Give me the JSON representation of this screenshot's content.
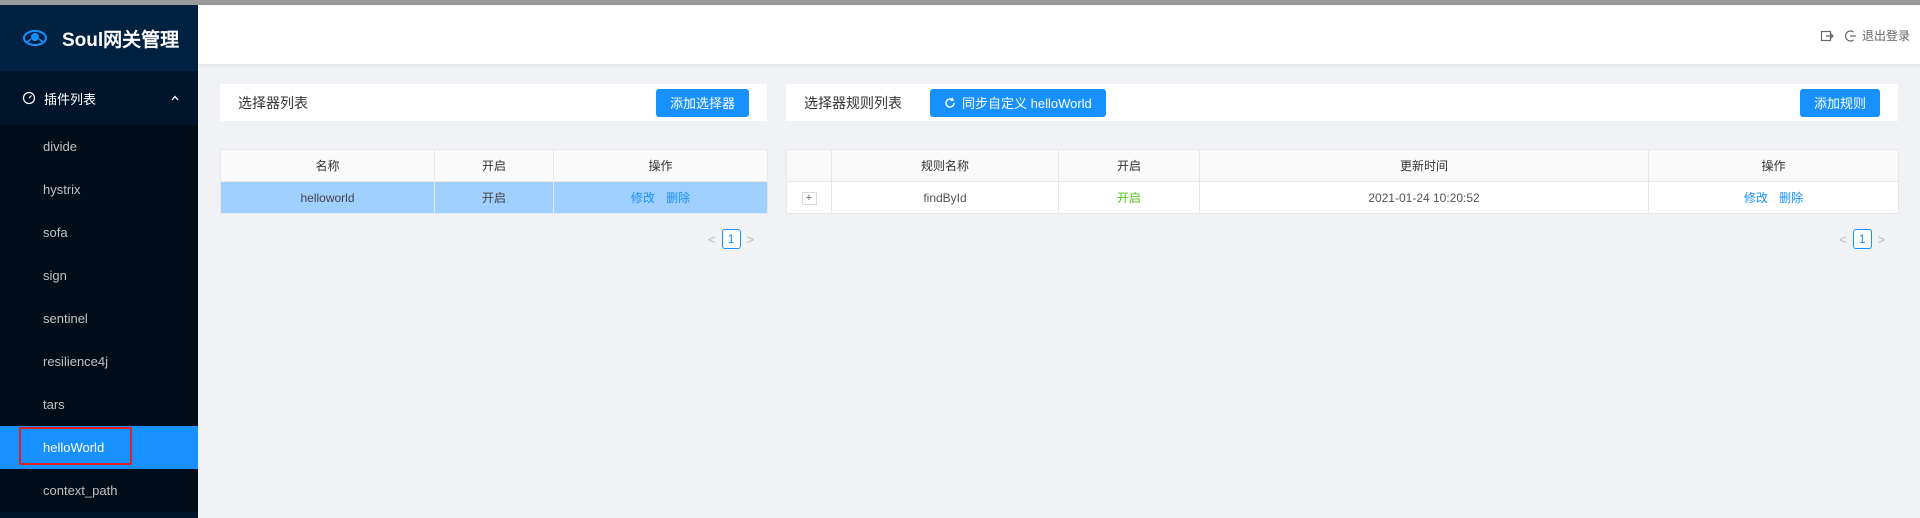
{
  "app": {
    "title": "Soul网关管理"
  },
  "sidebar": {
    "group_label": "插件列表",
    "items": [
      {
        "label": "divide"
      },
      {
        "label": "hystrix"
      },
      {
        "label": "sofa"
      },
      {
        "label": "sign"
      },
      {
        "label": "sentinel"
      },
      {
        "label": "resilience4j"
      },
      {
        "label": "tars"
      },
      {
        "label": "helloWorld"
      },
      {
        "label": "context_path"
      }
    ],
    "active_item": "helloWorld"
  },
  "header": {
    "logout_label": "退出登录",
    "icons": [
      "export-icon",
      "logout-icon"
    ]
  },
  "selector_panel": {
    "title": "选择器列表",
    "add_button": "添加选择器",
    "columns": [
      "名称",
      "开启",
      "操作"
    ],
    "rows": [
      {
        "name": "helloworld",
        "enabled": "开启",
        "edit": "修改",
        "delete": "删除"
      }
    ],
    "page": "1"
  },
  "rule_panel": {
    "title": "选择器规则列表",
    "sync_button": "同步自定义 helloWorld",
    "add_button": "添加规则",
    "columns": [
      "",
      "规则名称",
      "开启",
      "更新时间",
      "操作"
    ],
    "rows": [
      {
        "expand": "+",
        "name": "findById",
        "enabled": "开启",
        "updated": "2021-01-24 10:20:52",
        "edit": "修改",
        "delete": "删除"
      }
    ],
    "page": "1"
  },
  "colors": {
    "primary": "#1890ff",
    "sidebar_bg": "#001529",
    "enabled_green": "#52c41a",
    "highlight_red": "#e02020"
  }
}
